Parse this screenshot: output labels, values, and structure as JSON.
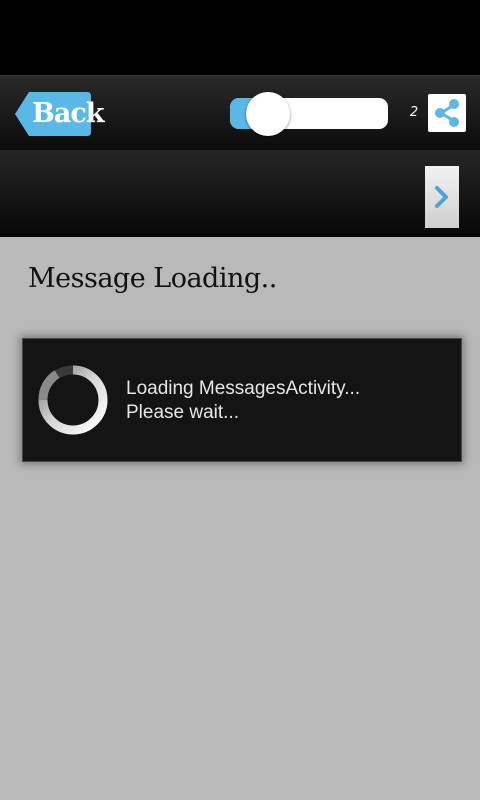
{
  "header": {
    "back_label": "Back",
    "toggle": {
      "state": "on",
      "fill_fraction": 0.24
    },
    "share_count": "2",
    "share_icon": "share-icon"
  },
  "secondary_bar": {
    "next_icon": "chevron-right-icon"
  },
  "content": {
    "title": "Message Loading..",
    "dialog": {
      "line1": "Loading MessagesActivity...",
      "line2": "Please wait...",
      "spinner_icon": "spinner-icon"
    }
  },
  "colors": {
    "accent": "#5ab8e6",
    "background": "#b9b9b9",
    "dialog": "#141414"
  }
}
